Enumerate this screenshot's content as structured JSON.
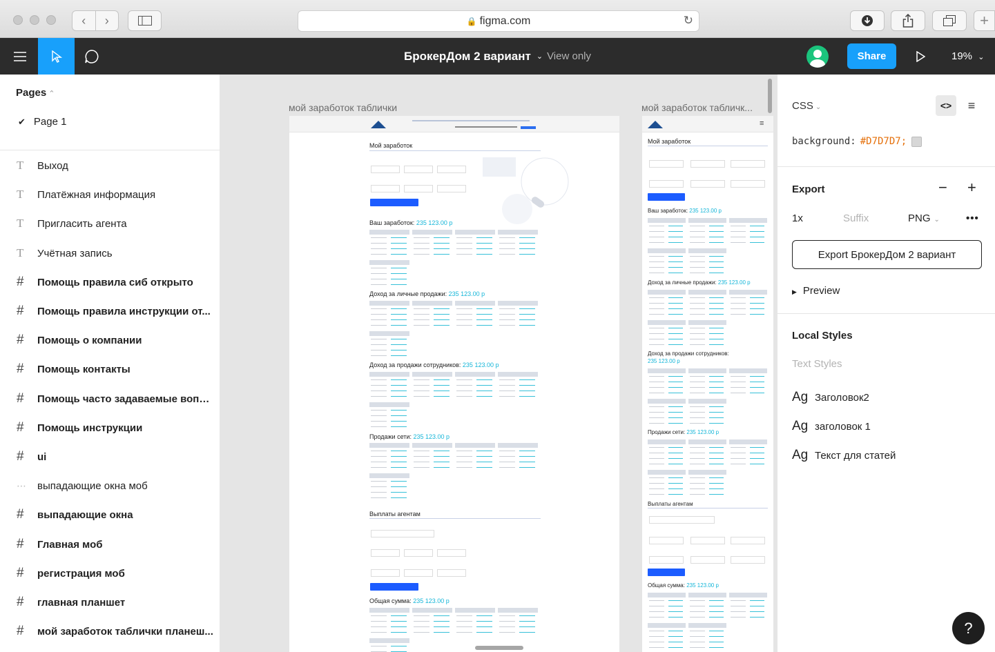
{
  "browser": {
    "url": "figma.com",
    "lock_icon": "lock-icon",
    "reload_icon": "reload-icon"
  },
  "toolbar": {
    "file_name": "БрокерДом 2 вариант",
    "view_mode": "View only",
    "share_label": "Share",
    "zoom": "19%",
    "active_tool": "move-tool",
    "accent": "#18a0fb"
  },
  "pages": {
    "title": "Pages",
    "current": "Page 1"
  },
  "layers": [
    {
      "type": "text",
      "name": "Выход"
    },
    {
      "type": "text",
      "name": "Платёжная информация"
    },
    {
      "type": "text",
      "name": "Пригласить агента"
    },
    {
      "type": "text",
      "name": "Учётная запись"
    },
    {
      "type": "frame",
      "name": "Помощь правила сиб открыто"
    },
    {
      "type": "frame",
      "name": "Помощь правила инструкции от..."
    },
    {
      "type": "frame",
      "name": "Помощь о компании"
    },
    {
      "type": "frame",
      "name": "Помощь контакты"
    },
    {
      "type": "frame",
      "name": "Помощь часто задаваемые вопр..."
    },
    {
      "type": "frame",
      "name": "Помощь инструкции"
    },
    {
      "type": "frame",
      "name": "ui"
    },
    {
      "type": "group",
      "name": "выпадающие окна моб"
    },
    {
      "type": "frame",
      "name": "выпадающие окна"
    },
    {
      "type": "frame",
      "name": "Главная моб"
    },
    {
      "type": "frame",
      "name": "регистрация моб"
    },
    {
      "type": "frame",
      "name": "главная планшет"
    },
    {
      "type": "frame",
      "name": "мой заработок таблички планеш..."
    }
  ],
  "canvas": {
    "background": "#e5e5e5",
    "frames": [
      {
        "label": "мой заработок таблички",
        "sections": {
          "title": "Мой заработок",
          "earned": "Ваш заработок:",
          "personal": "Доход за личные продажи:",
          "staff": "Доход за продажи сотрудников:",
          "network": "Продажи сети:",
          "payouts": "Выплаты агентам",
          "total": "Общая сумма:",
          "amount": "235 123.00 р",
          "amount_short": "235 123.00 р"
        }
      },
      {
        "label": "мой заработок табличк...",
        "sections": {
          "title": "Мой заработок",
          "earned": "Ваш заработок:",
          "personal": "Доход за личные продажи:",
          "staff": "Доход за продажи сотрудников:",
          "network": "Продажи сети:",
          "payouts": "Выплаты агентам",
          "total": "Общая сумма:",
          "amount": "235 123.00 р"
        }
      }
    ]
  },
  "inspect": {
    "code_lang": "CSS",
    "property": "background:",
    "value": "#D7D7D7;",
    "swatch_color": "#D7D7D7",
    "export_title": "Export",
    "scale": "1x",
    "suffix_placeholder": "Suffix",
    "format": "PNG",
    "export_button": "Export БрокерДом 2 вариант",
    "preview": "Preview",
    "local_styles": "Local Styles",
    "text_styles_label": "Text Styles",
    "styles": [
      {
        "icon": "Ag",
        "name": "Заголовок2"
      },
      {
        "icon": "Ag",
        "name": "заголовок 1"
      },
      {
        "icon": "Ag",
        "name": "Текст для статей"
      }
    ]
  },
  "help": "?"
}
